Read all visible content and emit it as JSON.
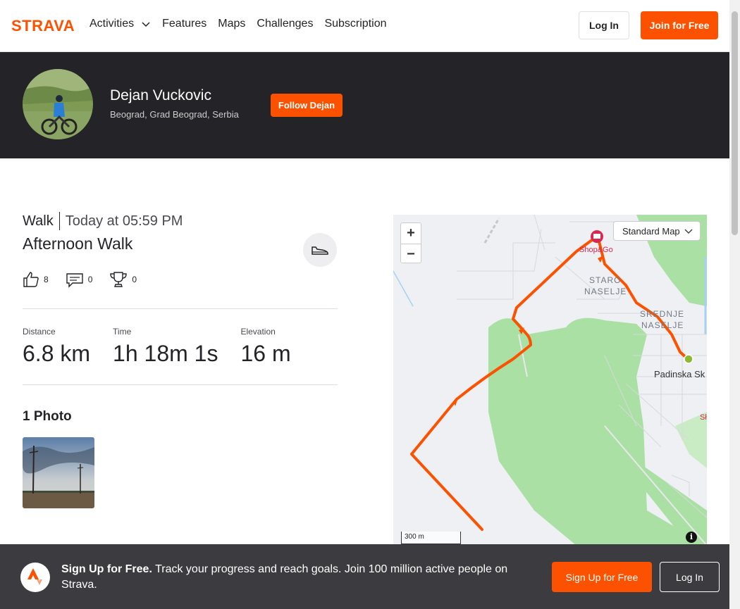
{
  "nav": {
    "brand": "STRAVA",
    "links": [
      "Activities",
      "Features",
      "Maps",
      "Challenges",
      "Subscription"
    ],
    "login_label": "Log In",
    "join_label": "Join for Free"
  },
  "profile": {
    "name": "Dejan Vuckovic",
    "location": "Beograd, Grad Beograd, Serbia",
    "follow_label": "Follow Dejan"
  },
  "activity": {
    "type": "Walk",
    "time": "Today at 05:59 PM",
    "title": "Afternoon Walk",
    "kudos": "8",
    "comments": "0",
    "achievements": "0",
    "stats": [
      {
        "label": "Distance",
        "value": "6.8 km"
      },
      {
        "label": "Time",
        "value": "1h 18m 1s"
      },
      {
        "label": "Elevation",
        "value": "16 m"
      }
    ]
  },
  "photos": {
    "heading": "1 Photo"
  },
  "map": {
    "zoom_in": "+",
    "zoom_out": "−",
    "style_select": "Standard Map",
    "scale": "300 m",
    "info": "i",
    "labels": {
      "shop": "Shop&Go",
      "staro_1": "STARO",
      "staro_2": "NASELJE",
      "srednje_1": "SREDNJE",
      "srednje_2": "NASELJE",
      "padinska": "Padinska Sk",
      "edge": "Sł"
    },
    "colors": {
      "route": "#fc5200",
      "park": "#aae0a4",
      "land": "#eef0f3"
    }
  },
  "banner": {
    "headline": "Sign Up for Free.",
    "text": " Track your progress and reach goals. Join 100 million active people on Strava.",
    "signup_label": "Sign Up for Free",
    "login_label": "Log In"
  },
  "colors": {
    "brand": "#fc5200",
    "dark": "#242428"
  }
}
